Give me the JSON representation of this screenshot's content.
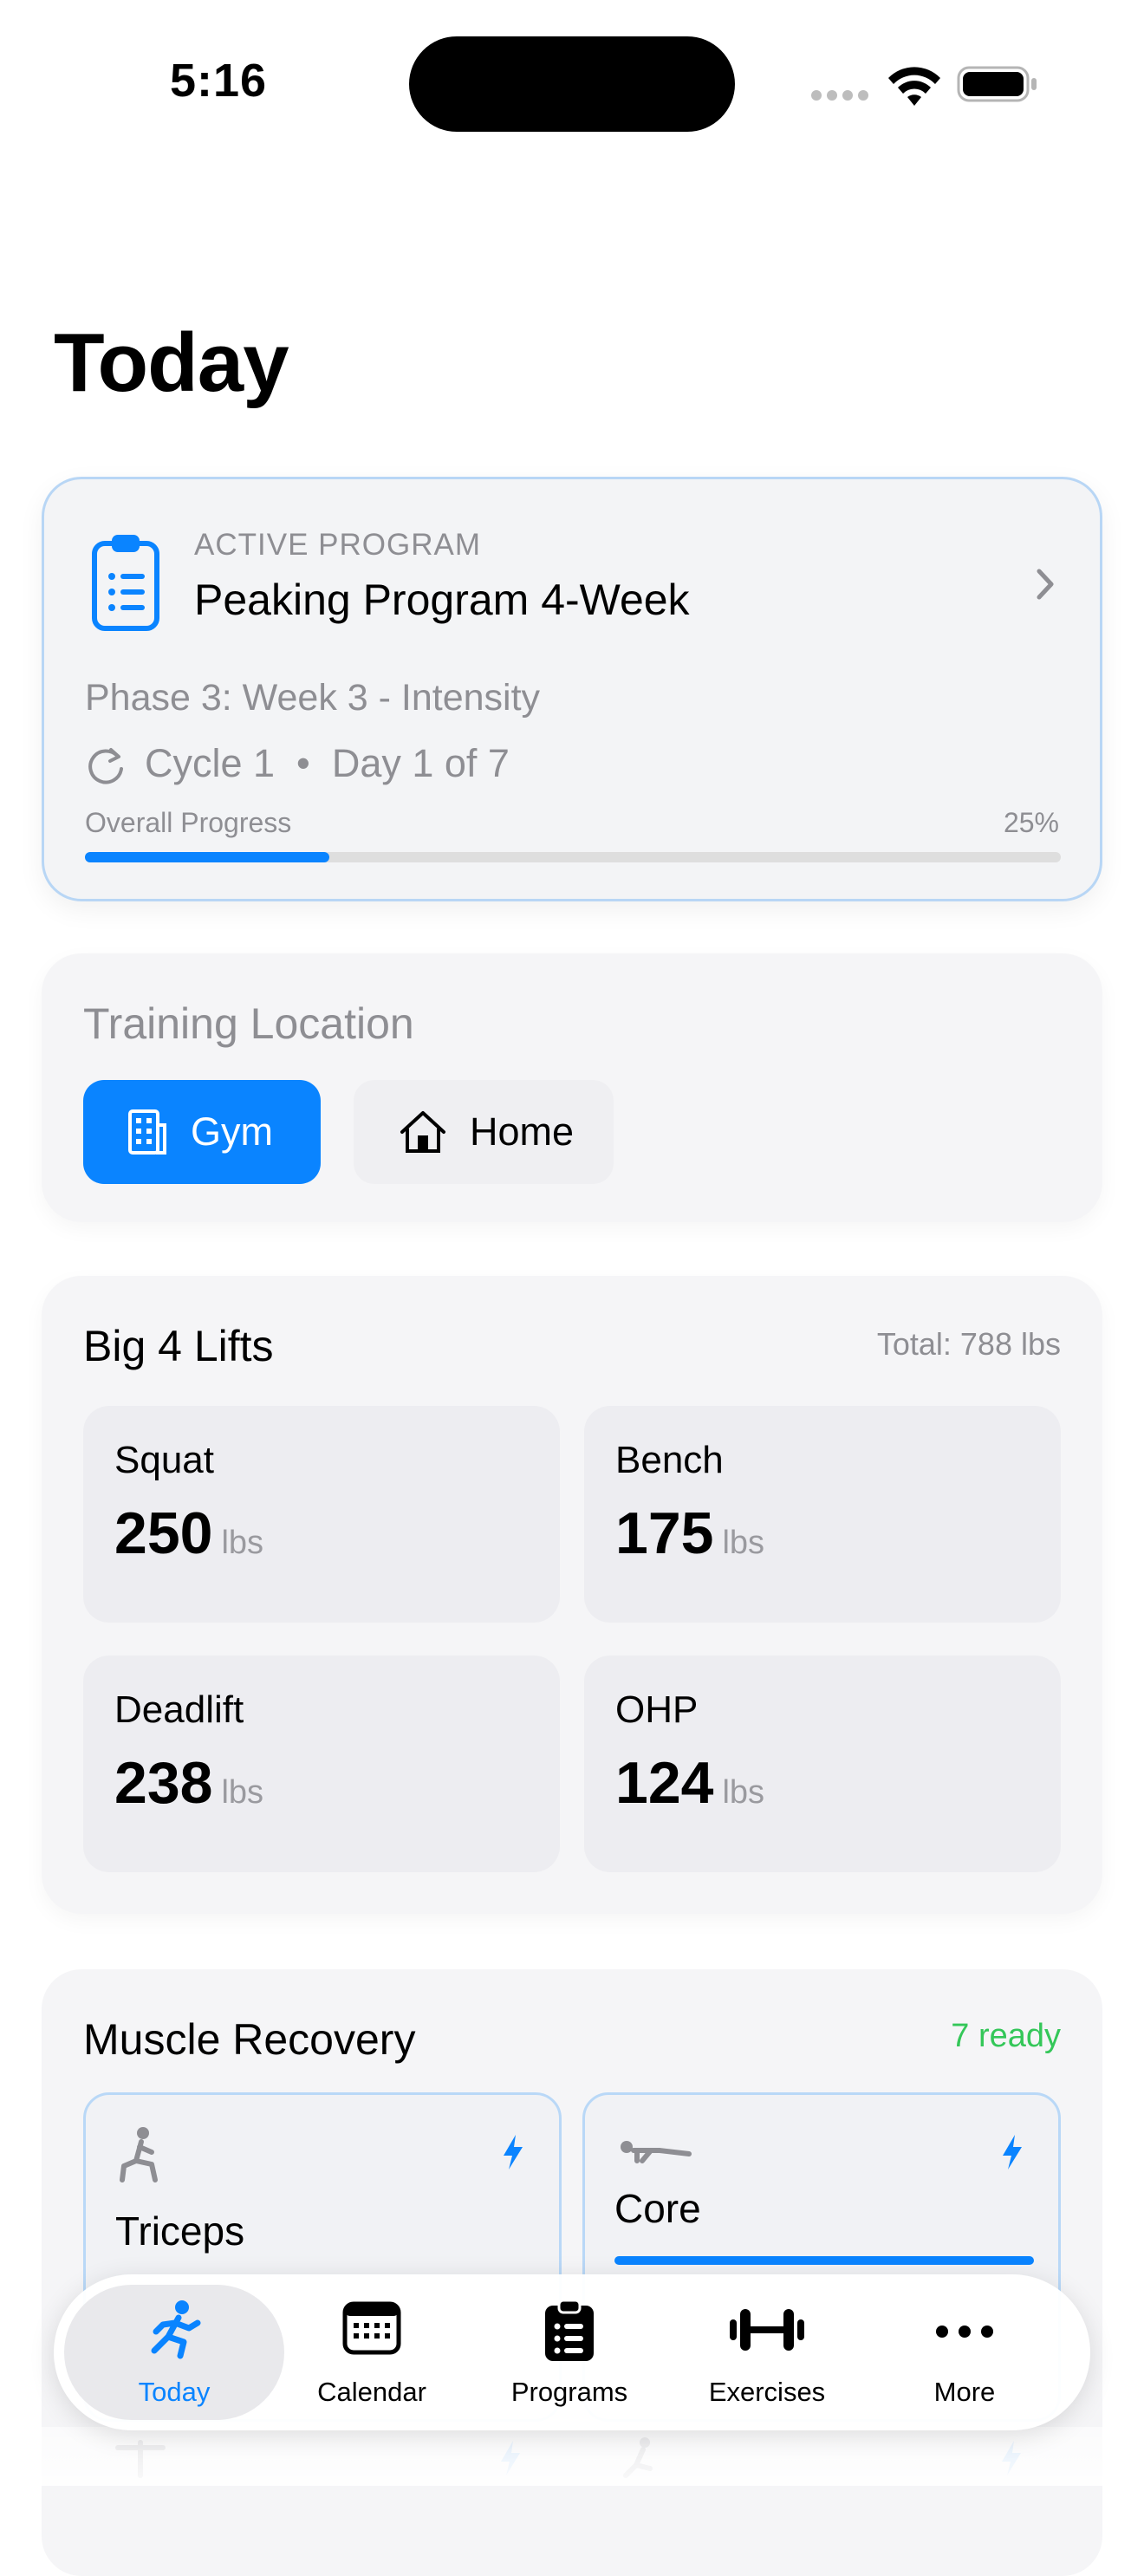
{
  "status_bar": {
    "time": "5:16"
  },
  "page": {
    "title": "Today"
  },
  "program": {
    "label": "ACTIVE PROGRAM",
    "name": "Peaking Program 4-Week",
    "phase": "Phase 3: Week 3 - Intensity",
    "cycle": "Cycle 1  •  Day 1 of 7",
    "progress_label": "Overall Progress",
    "progress_text": "25%",
    "progress_value": 0.25
  },
  "location": {
    "title": "Training Location",
    "options": [
      {
        "label": "Gym",
        "selected": true
      },
      {
        "label": "Home",
        "selected": false
      }
    ]
  },
  "lifts": {
    "title": "Big 4 Lifts",
    "total": "Total: 788 lbs",
    "items": [
      {
        "name": "Squat",
        "value": "250",
        "unit": "lbs"
      },
      {
        "name": "Bench",
        "value": "175",
        "unit": "lbs"
      },
      {
        "name": "Deadlift",
        "value": "238",
        "unit": "lbs"
      },
      {
        "name": "OHP",
        "value": "124",
        "unit": "lbs"
      }
    ]
  },
  "recovery": {
    "title": "Muscle Recovery",
    "ready": "7 ready",
    "items": [
      {
        "name": "Triceps",
        "icon": "lunge-figure-icon"
      },
      {
        "name": "Core",
        "icon": "plank-figure-icon"
      }
    ]
  },
  "tabs": [
    {
      "label": "Today",
      "icon": "running-figure-icon",
      "active": true
    },
    {
      "label": "Calendar",
      "icon": "calendar-icon",
      "active": false
    },
    {
      "label": "Programs",
      "icon": "clipboard-icon",
      "active": false
    },
    {
      "label": "Exercises",
      "icon": "dumbbell-icon",
      "active": false
    },
    {
      "label": "More",
      "icon": "ellipsis-icon",
      "active": false
    }
  ],
  "colors": {
    "accent": "#0a84ff",
    "ready": "#34c759",
    "card": "#f5f5f7",
    "muted": "#8e8e93"
  }
}
